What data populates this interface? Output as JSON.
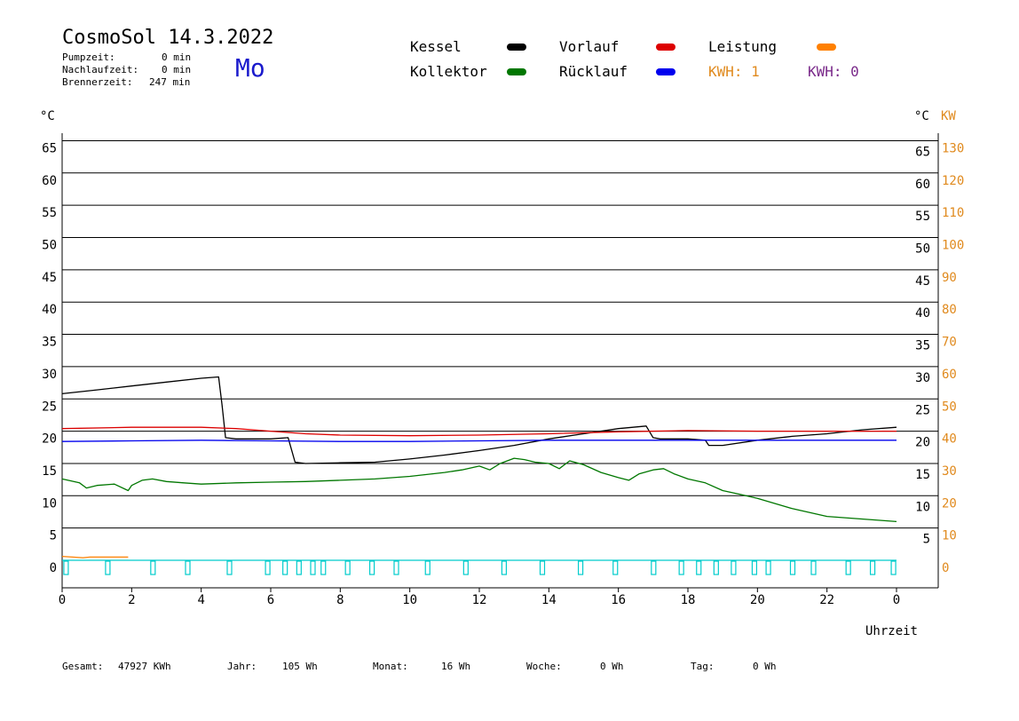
{
  "header": {
    "title": "CosmoSol 14.3.2022",
    "pumpzeit_label": "Pumpzeit:",
    "pumpzeit_value": "0 min",
    "nachlauf_label": "Nachlaufzeit:",
    "nachlauf_value": "0 min",
    "brenner_label": "Brennerzeit:",
    "brenner_value": "247 min",
    "weekday": "Mo"
  },
  "legend": {
    "kessel": "Kessel",
    "vorlauf": "Vorlauf",
    "leistung": "Leistung",
    "kollektor": "Kollektor",
    "ruecklauf": "Rücklauf",
    "kwh1": "KWH: 1",
    "kwh2": "KWH: 0"
  },
  "colors": {
    "kessel": "#000000",
    "vorlauf": "#dd0000",
    "leistung": "#ff8000",
    "kollektor": "#007700",
    "ruecklauf": "#0000ee",
    "kwh1": "#e08a1e",
    "kwh2": "#7a2a8a",
    "pump": "#00cccc",
    "axis_right_kw": "#e08a1e"
  },
  "footer": {
    "gesamt_label": "Gesamt:",
    "gesamt_value": "47927 KWh",
    "jahr_label": "Jahr:",
    "jahr_value": "105 Wh",
    "monat_label": "Monat:",
    "monat_value": "16 Wh",
    "woche_label": "Woche:",
    "woche_value": "0 Wh",
    "tag_label": "Tag:",
    "tag_value": "0 Wh"
  },
  "chart_data": {
    "type": "line",
    "xlabel": "Uhrzeit",
    "ylabel_left": "°C",
    "ylabel_right_c": "°C",
    "ylabel_right_kw": "KW",
    "xlim": [
      0,
      24
    ],
    "ylim": [
      0,
      65
    ],
    "y_ticks": [
      0,
      5,
      10,
      15,
      20,
      25,
      30,
      35,
      40,
      45,
      50,
      55,
      60,
      65
    ],
    "y_ticks_right_c": [
      5,
      10,
      15,
      20,
      25,
      30,
      35,
      40,
      45,
      50,
      55,
      60,
      65
    ],
    "y_ticks_right_kw": [
      0,
      10,
      20,
      30,
      40,
      50,
      60,
      70,
      80,
      90,
      100,
      110,
      120,
      130
    ],
    "x_ticks": [
      "0",
      "2",
      "4",
      "6",
      "8",
      "10",
      "12",
      "14",
      "16",
      "18",
      "20",
      "22",
      "0"
    ],
    "grid": "horizontal",
    "series": [
      {
        "name": "Kessel",
        "color": "#000000",
        "x": [
          0,
          1,
          2,
          3,
          4,
          4.5,
          4.6,
          4.7,
          5,
          6,
          6.5,
          6.7,
          7,
          8,
          9,
          10,
          11,
          12,
          13,
          14,
          15,
          16,
          16.8,
          17.0,
          17.2,
          18,
          18.5,
          18.6,
          19,
          20,
          21,
          22,
          23,
          24
        ],
        "y": [
          25.8,
          26.4,
          27.0,
          27.6,
          28.2,
          28.4,
          24.0,
          19.0,
          18.8,
          18.8,
          19.0,
          15.2,
          15.0,
          15.1,
          15.2,
          15.7,
          16.3,
          17.0,
          17.8,
          18.8,
          19.6,
          20.4,
          20.8,
          19.0,
          18.8,
          18.8,
          18.6,
          17.8,
          17.8,
          18.6,
          19.2,
          19.6,
          20.2,
          20.6
        ]
      },
      {
        "name": "Vorlauf",
        "color": "#dd0000",
        "x": [
          0,
          2,
          4,
          5,
          6,
          7,
          8,
          10,
          12,
          14,
          16,
          18,
          20,
          22,
          24
        ],
        "y": [
          20.4,
          20.6,
          20.6,
          20.4,
          20.0,
          19.6,
          19.4,
          19.3,
          19.4,
          19.6,
          19.9,
          20.1,
          20.0,
          20.0,
          20.0
        ]
      },
      {
        "name": "Rücklauf",
        "color": "#0000ee",
        "x": [
          0,
          2,
          4,
          6,
          8,
          10,
          12,
          14,
          16,
          18,
          20,
          22,
          24
        ],
        "y": [
          18.4,
          18.5,
          18.6,
          18.5,
          18.4,
          18.4,
          18.5,
          18.6,
          18.6,
          18.6,
          18.6,
          18.6,
          18.6
        ]
      },
      {
        "name": "Kollektor",
        "color": "#007700",
        "x": [
          0,
          0.5,
          0.7,
          1,
          1.5,
          1.9,
          2.0,
          2.3,
          2.6,
          3,
          3.5,
          4,
          5,
          6,
          7,
          8,
          9,
          10,
          11,
          11.5,
          12,
          12.3,
          12.6,
          13,
          13.3,
          13.6,
          14,
          14.3,
          14.6,
          15,
          15.5,
          16,
          16.3,
          16.6,
          17,
          17.3,
          17.6,
          18,
          18.5,
          19,
          19.5,
          20,
          21,
          22,
          23,
          24
        ],
        "y": [
          12.6,
          12.0,
          11.2,
          11.6,
          11.8,
          10.8,
          11.6,
          12.4,
          12.6,
          12.2,
          12.0,
          11.8,
          12.0,
          12.1,
          12.2,
          12.4,
          12.6,
          13.0,
          13.6,
          14.0,
          14.6,
          14.0,
          15.0,
          15.8,
          15.6,
          15.2,
          15.0,
          14.2,
          15.4,
          14.8,
          13.6,
          12.8,
          12.4,
          13.4,
          14.0,
          14.2,
          13.4,
          12.6,
          12.0,
          10.8,
          10.2,
          9.6,
          8.0,
          6.8,
          6.4,
          6.0
        ]
      },
      {
        "name": "Leistung",
        "color": "#ff8000",
        "x": [
          0,
          0.6,
          0.8,
          1.9
        ],
        "y": [
          0.6,
          0.4,
          0.5,
          0.5
        ]
      }
    ],
    "pump_markers_hours": [
      0.1,
      1.3,
      2.6,
      3.6,
      4.8,
      5.9,
      6.4,
      6.8,
      7.2,
      7.5,
      8.2,
      8.9,
      9.6,
      10.5,
      11.6,
      12.7,
      13.8,
      14.9,
      15.9,
      17.0,
      17.8,
      18.3,
      18.8,
      19.3,
      19.9,
      20.3,
      21.0,
      21.6,
      22.6,
      23.3,
      23.9
    ]
  }
}
